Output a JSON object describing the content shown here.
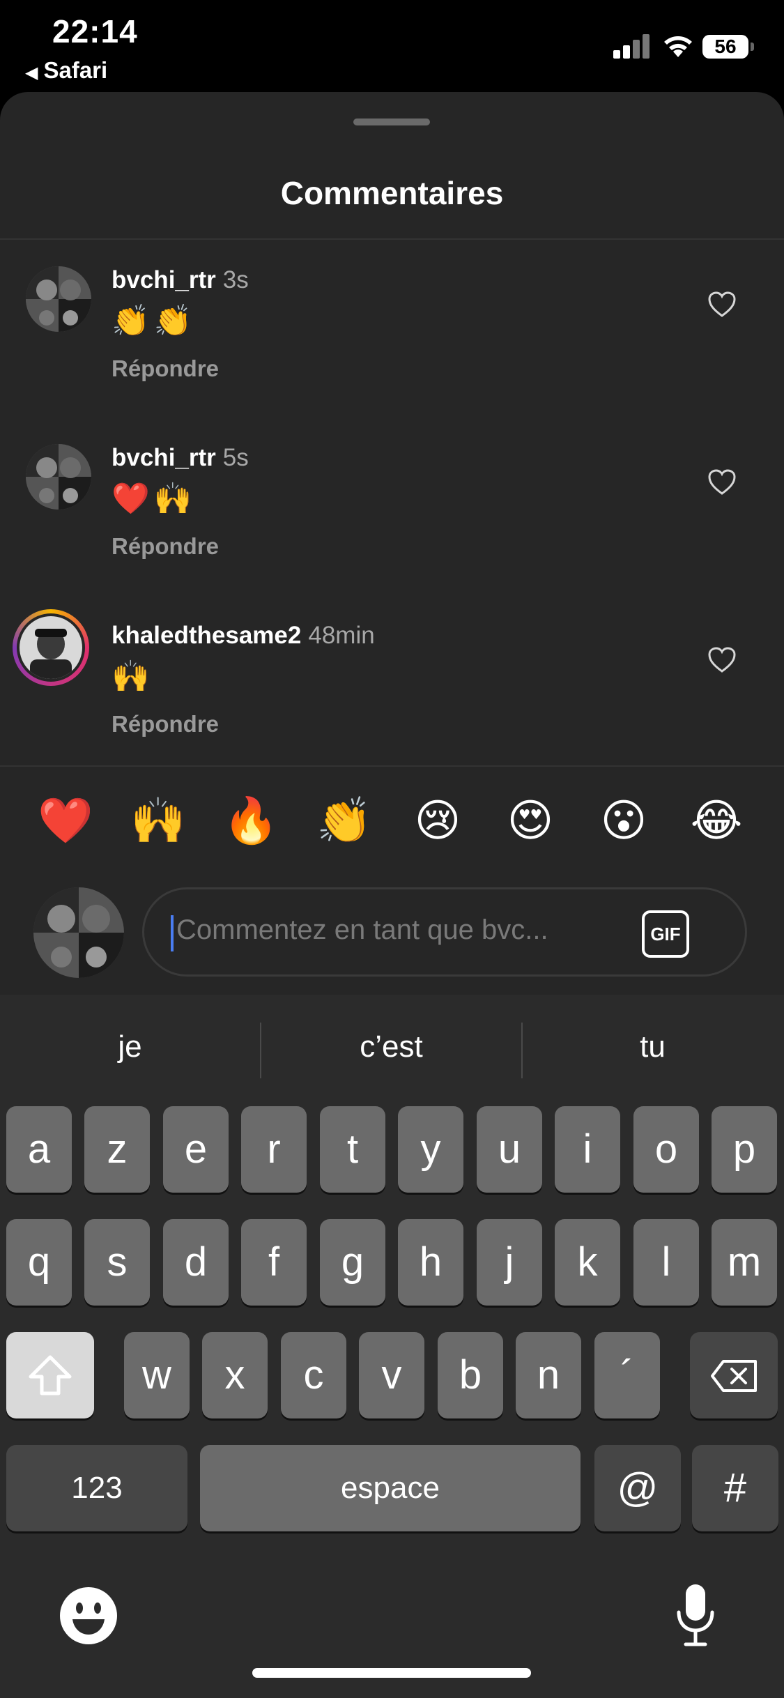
{
  "status_bar": {
    "time": "22:14",
    "back_app": "Safari",
    "battery": "56"
  },
  "sheet": {
    "title": "Commentaires"
  },
  "comments": [
    {
      "username": "bvchi_rtr",
      "time": "3s",
      "text": "👏👏",
      "reply_label": "Répondre"
    },
    {
      "username": "bvchi_rtr",
      "time": "5s",
      "text": "❤️🙌",
      "reply_label": "Répondre"
    },
    {
      "username": "khaledthesame2",
      "time": "48min",
      "text": "🙌",
      "reply_label": "Répondre"
    }
  ],
  "reactions": [
    "❤️",
    "🙌",
    "🔥",
    "👏",
    "😢",
    "😍",
    "😮",
    "😂"
  ],
  "composer": {
    "placeholder": "Commentez en tant que bvc...",
    "gif_label": "GIF"
  },
  "keyboard": {
    "suggestions": [
      "je",
      "c’est",
      "tu"
    ],
    "row1": [
      "a",
      "z",
      "e",
      "r",
      "t",
      "y",
      "u",
      "i",
      "o",
      "p"
    ],
    "row2": [
      "q",
      "s",
      "d",
      "f",
      "g",
      "h",
      "j",
      "k",
      "l",
      "m"
    ],
    "row3": [
      "w",
      "x",
      "c",
      "v",
      "b",
      "n",
      "´"
    ],
    "numbers_key": "123",
    "space_key": "espace",
    "at_key": "@",
    "hash_key": "#"
  }
}
